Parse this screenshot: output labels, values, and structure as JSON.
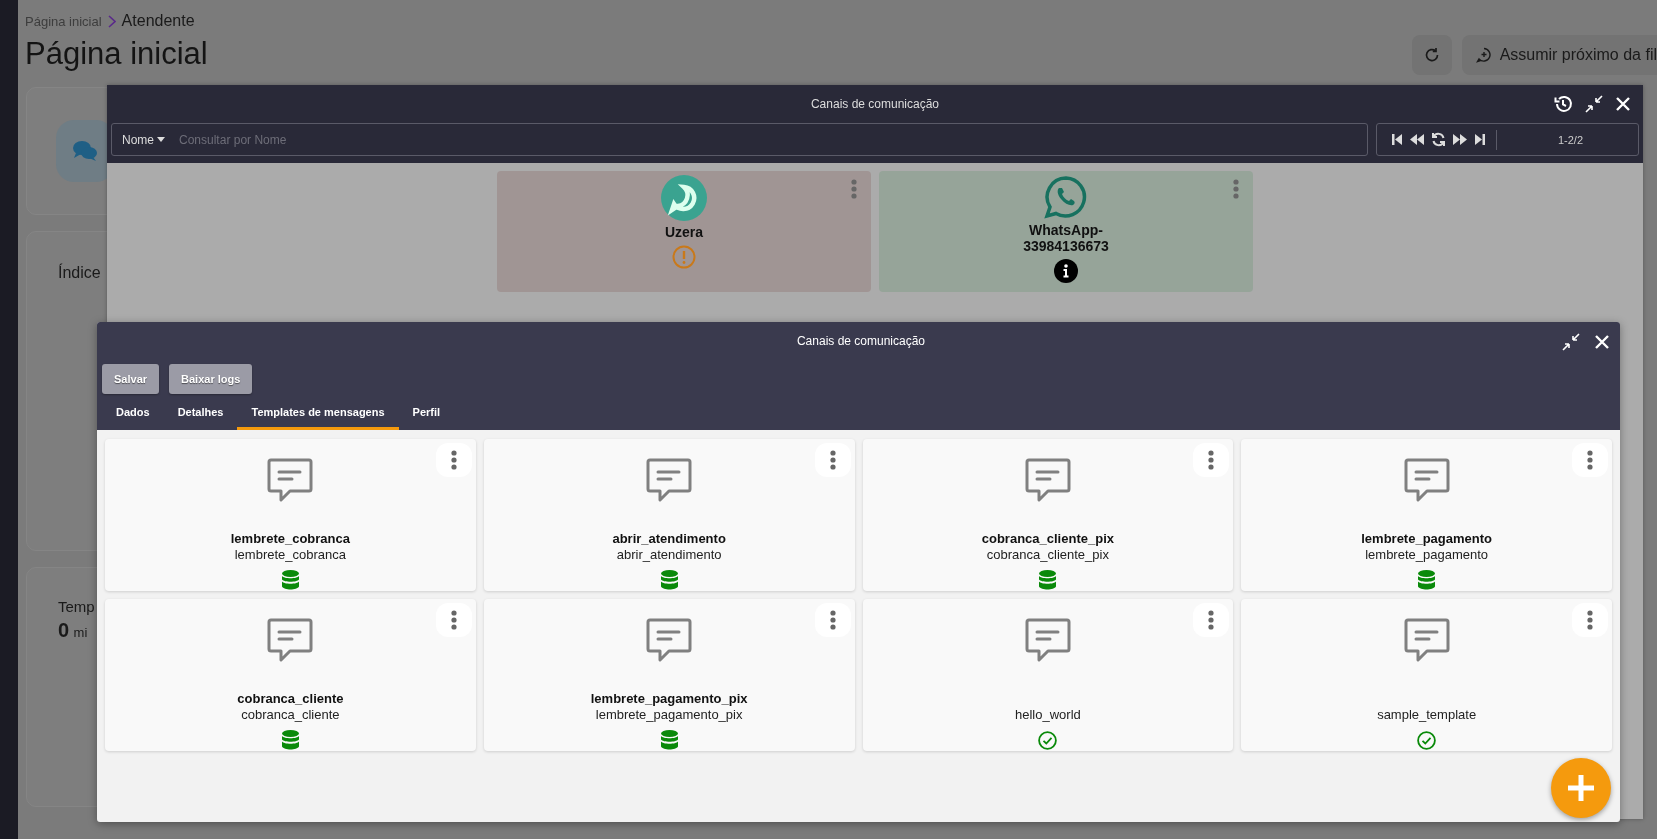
{
  "page": {
    "breadcrumb": [
      {
        "label": "Página inicial"
      },
      {
        "label": "Atendente"
      }
    ],
    "title": "Página inicial",
    "actions": {
      "next_in_queue": "Assumir próximo da fil"
    },
    "panels": [
      {
        "kind": "icon"
      },
      {
        "kind": "text",
        "label": "Índice"
      },
      {
        "kind": "stat",
        "label": "Temp",
        "value": "0",
        "unit": "mi"
      }
    ]
  },
  "channels_dialog": {
    "title": "Canais de comunicação",
    "search": {
      "filter": "Nome",
      "placeholder": "Consultar por Nome"
    },
    "pager": {
      "range": "1-2/2"
    },
    "channels": [
      {
        "name": "Uzera",
        "kind": "uzera",
        "warning": true,
        "color": "#a09594"
      },
      {
        "name": "WhatsApp-33984136673",
        "kind": "whatsapp",
        "warning": false,
        "color": "#96a499"
      }
    ]
  },
  "channel_dialog": {
    "title": "Canais de comunicação",
    "buttons": [
      "Salvar",
      "Baixar logs"
    ],
    "tabs": [
      {
        "label": "Dados",
        "selected": false
      },
      {
        "label": "Detalhes",
        "selected": false
      },
      {
        "label": "Templates de mensagens",
        "selected": true
      },
      {
        "label": "Perfil",
        "selected": false
      }
    ],
    "templates": [
      {
        "title": "lembrete_cobranca",
        "subtitle": "lembrete_cobranca",
        "approved": false
      },
      {
        "title": "abrir_atendimento",
        "subtitle": "abrir_atendimento",
        "approved": false
      },
      {
        "title": "cobranca_cliente_pix",
        "subtitle": "cobranca_cliente_pix",
        "approved": false
      },
      {
        "title": "lembrete_pagamento",
        "subtitle": "lembrete_pagamento",
        "approved": false
      },
      {
        "title": "cobranca_cliente",
        "subtitle": "cobranca_cliente",
        "approved": false
      },
      {
        "title": "lembrete_pagamento_pix",
        "subtitle": "lembrete_pagamento_pix",
        "approved": false
      },
      {
        "subtitle": "hello_world",
        "approved": true
      },
      {
        "subtitle": "sample_template",
        "approved": true
      }
    ]
  }
}
